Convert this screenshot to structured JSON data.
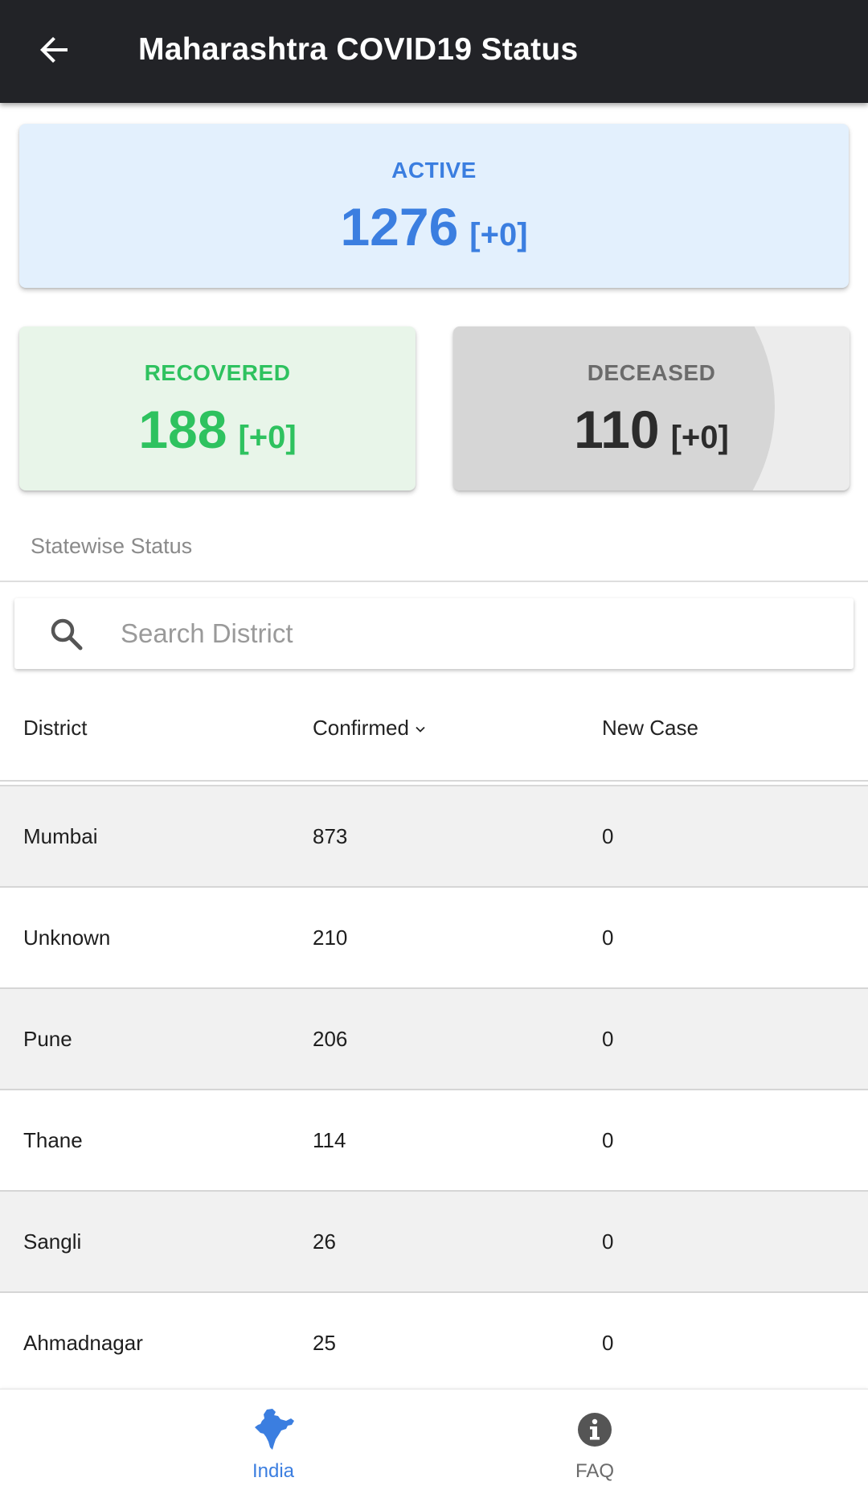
{
  "appbar": {
    "title": "Maharashtra COVID19 Status",
    "back_icon": "arrow-left-icon"
  },
  "cards": {
    "active": {
      "label": "ACTIVE",
      "value": "1276",
      "delta": "[+0]",
      "color": "#3b7ee0",
      "background": "#e3f0fd"
    },
    "recovered": {
      "label": "RECOVERED",
      "value": "188",
      "delta": "[+0]",
      "color": "#2ec25f",
      "background": "#e8f5e9"
    },
    "deceased": {
      "label": "DECEASED",
      "value": "110",
      "delta": "[+0]",
      "color": "#2c2c2c",
      "background": "#ececec"
    }
  },
  "section": {
    "title": "Statewise Status"
  },
  "search": {
    "placeholder": "Search District",
    "value": "",
    "icon": "search-icon"
  },
  "table": {
    "columns": {
      "district": "District",
      "confirmed": "Confirmed",
      "new_case": "New Case"
    },
    "sorted_by": "Confirmed",
    "rows": [
      {
        "district": "Mumbai",
        "confirmed": "873",
        "new_case": "0"
      },
      {
        "district": "Unknown",
        "confirmed": "210",
        "new_case": "0"
      },
      {
        "district": "Pune",
        "confirmed": "206",
        "new_case": "0"
      },
      {
        "district": "Thane",
        "confirmed": "114",
        "new_case": "0"
      },
      {
        "district": "Sangli",
        "confirmed": "26",
        "new_case": "0"
      },
      {
        "district": "Ahmadnagar",
        "confirmed": "25",
        "new_case": "0"
      }
    ]
  },
  "bottom_nav": {
    "items": [
      {
        "label": "India",
        "icon": "india-map-icon",
        "active": true,
        "color": "#3b7ee0"
      },
      {
        "label": "FAQ",
        "icon": "info-icon",
        "active": false,
        "color": "#6b6b6b"
      }
    ]
  }
}
